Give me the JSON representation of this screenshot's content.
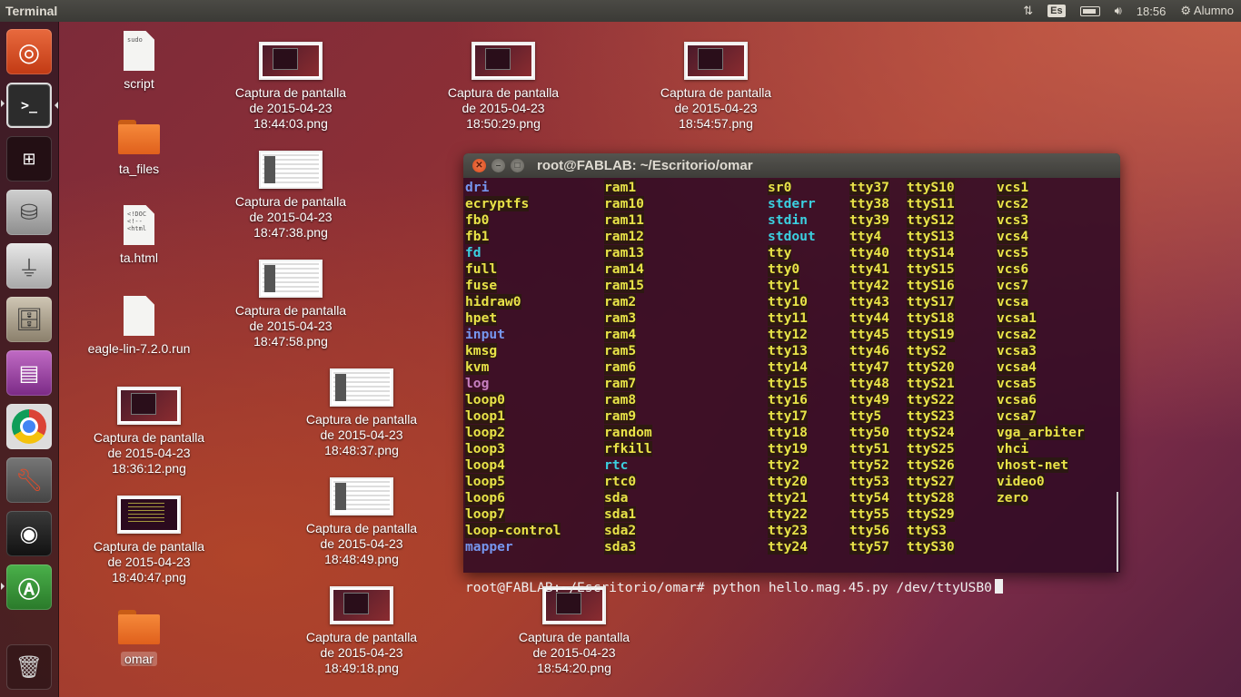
{
  "top_panel": {
    "app_title": "Terminal",
    "keyboard": "Es",
    "time": "18:56",
    "user": "Alumno"
  },
  "launcher": {
    "items": [
      "Ubuntu Dash",
      "Terminal",
      "Workspace Switcher",
      "Disk",
      "USB Drive",
      "Files",
      "Ubuntu Software",
      "Chrome",
      "System Settings",
      "Webcam",
      "Software Updater",
      "Trash"
    ]
  },
  "desktop": {
    "files": [
      {
        "label": "script",
        "badge": "sudo"
      },
      {
        "label": "ta_files"
      },
      {
        "label": "ta.html",
        "badge": "<!DOC\n<!--\n<html"
      },
      {
        "label": "eagle-lin-7.2.0.run"
      },
      {
        "label": "omar"
      }
    ],
    "screenshots": [
      {
        "l1": "Captura de pantalla",
        "l2": "de 2015-04-23",
        "l3": "18:44:03.png"
      },
      {
        "l1": "Captura de pantalla",
        "l2": "de 2015-04-23",
        "l3": "18:50:29.png"
      },
      {
        "l1": "Captura de pantalla",
        "l2": "de 2015-04-23",
        "l3": "18:54:57.png"
      },
      {
        "l1": "Captura de pantalla",
        "l2": "de 2015-04-23",
        "l3": "18:47:38.png"
      },
      {
        "l1": "Captura de pantalla",
        "l2": "de 2015-04-23",
        "l3": "18:47:58.png"
      },
      {
        "l1": "Captura de pantalla",
        "l2": "de 2015-04-23",
        "l3": "18:36:12.png"
      },
      {
        "l1": "Captura de pantalla",
        "l2": "de 2015-04-23",
        "l3": "18:48:37.png"
      },
      {
        "l1": "Captura de pantalla",
        "l2": "de 2015-04-23",
        "l3": "18:40:47.png"
      },
      {
        "l1": "Captura de pantalla",
        "l2": "de 2015-04-23",
        "l3": "18:48:49.png"
      },
      {
        "l1": "Captura de pantalla",
        "l2": "de 2015-04-23",
        "l3": "18:49:18.png"
      },
      {
        "l1": "Captura de pantalla",
        "l2": "de 2015-04-23",
        "l3": "18:54:20.png"
      }
    ]
  },
  "terminal": {
    "title": "root@FABLAB: ~/Escritorio/omar",
    "prompt": "root@FABLAB:~/Escritorio/omar# python hello.mag.45.py /dev/ttyUSB0",
    "columns": [
      [
        [
          "dri",
          "b"
        ],
        [
          "ecryptfs",
          "y"
        ],
        [
          "fb0",
          "y"
        ],
        [
          "fb1",
          "y"
        ],
        [
          "fd",
          "c"
        ],
        [
          "full",
          "y"
        ],
        [
          "fuse",
          "y"
        ],
        [
          "hidraw0",
          "y"
        ],
        [
          "hpet",
          "y"
        ],
        [
          "input",
          "b"
        ],
        [
          "kmsg",
          "y"
        ],
        [
          "kvm",
          "y"
        ],
        [
          "log",
          "m"
        ],
        [
          "loop0",
          "y"
        ],
        [
          "loop1",
          "y"
        ],
        [
          "loop2",
          "y"
        ],
        [
          "loop3",
          "y"
        ],
        [
          "loop4",
          "y"
        ],
        [
          "loop5",
          "y"
        ],
        [
          "loop6",
          "y"
        ],
        [
          "loop7",
          "y"
        ],
        [
          "loop-control",
          "y"
        ],
        [
          "mapper",
          "b"
        ]
      ],
      [
        [
          "ram1",
          "y"
        ],
        [
          "ram10",
          "y"
        ],
        [
          "ram11",
          "y"
        ],
        [
          "ram12",
          "y"
        ],
        [
          "ram13",
          "y"
        ],
        [
          "ram14",
          "y"
        ],
        [
          "ram15",
          "y"
        ],
        [
          "ram2",
          "y"
        ],
        [
          "ram3",
          "y"
        ],
        [
          "ram4",
          "y"
        ],
        [
          "ram5",
          "y"
        ],
        [
          "ram6",
          "y"
        ],
        [
          "ram7",
          "y"
        ],
        [
          "ram8",
          "y"
        ],
        [
          "ram9",
          "y"
        ],
        [
          "random",
          "y"
        ],
        [
          "rfkill",
          "y"
        ],
        [
          "rtc",
          "c"
        ],
        [
          "rtc0",
          "y"
        ],
        [
          "sda",
          "y"
        ],
        [
          "sda1",
          "y"
        ],
        [
          "sda2",
          "y"
        ],
        [
          "sda3",
          "y"
        ]
      ],
      [
        [
          "sr0",
          "y"
        ],
        [
          "stderr",
          "c"
        ],
        [
          "stdin",
          "c"
        ],
        [
          "stdout",
          "c"
        ],
        [
          "tty",
          "y"
        ],
        [
          "tty0",
          "y"
        ],
        [
          "tty1",
          "y"
        ],
        [
          "tty10",
          "y"
        ],
        [
          "tty11",
          "y"
        ],
        [
          "tty12",
          "y"
        ],
        [
          "tty13",
          "y"
        ],
        [
          "tty14",
          "y"
        ],
        [
          "tty15",
          "y"
        ],
        [
          "tty16",
          "y"
        ],
        [
          "tty17",
          "y"
        ],
        [
          "tty18",
          "y"
        ],
        [
          "tty19",
          "y"
        ],
        [
          "tty2",
          "y"
        ],
        [
          "tty20",
          "y"
        ],
        [
          "tty21",
          "y"
        ],
        [
          "tty22",
          "y"
        ],
        [
          "tty23",
          "y"
        ],
        [
          "tty24",
          "y"
        ]
      ],
      [
        [
          "tty37",
          "y"
        ],
        [
          "tty38",
          "y"
        ],
        [
          "tty39",
          "y"
        ],
        [
          "tty4",
          "y"
        ],
        [
          "tty40",
          "y"
        ],
        [
          "tty41",
          "y"
        ],
        [
          "tty42",
          "y"
        ],
        [
          "tty43",
          "y"
        ],
        [
          "tty44",
          "y"
        ],
        [
          "tty45",
          "y"
        ],
        [
          "tty46",
          "y"
        ],
        [
          "tty47",
          "y"
        ],
        [
          "tty48",
          "y"
        ],
        [
          "tty49",
          "y"
        ],
        [
          "tty5",
          "y"
        ],
        [
          "tty50",
          "y"
        ],
        [
          "tty51",
          "y"
        ],
        [
          "tty52",
          "y"
        ],
        [
          "tty53",
          "y"
        ],
        [
          "tty54",
          "y"
        ],
        [
          "tty55",
          "y"
        ],
        [
          "tty56",
          "y"
        ],
        [
          "tty57",
          "y"
        ]
      ],
      [
        [
          "ttyS10",
          "y"
        ],
        [
          "ttyS11",
          "y"
        ],
        [
          "ttyS12",
          "y"
        ],
        [
          "ttyS13",
          "y"
        ],
        [
          "ttyS14",
          "y"
        ],
        [
          "ttyS15",
          "y"
        ],
        [
          "ttyS16",
          "y"
        ],
        [
          "ttyS17",
          "y"
        ],
        [
          "ttyS18",
          "y"
        ],
        [
          "ttyS19",
          "y"
        ],
        [
          "ttyS2",
          "y"
        ],
        [
          "ttyS20",
          "y"
        ],
        [
          "ttyS21",
          "y"
        ],
        [
          "ttyS22",
          "y"
        ],
        [
          "ttyS23",
          "y"
        ],
        [
          "ttyS24",
          "y"
        ],
        [
          "ttyS25",
          "y"
        ],
        [
          "ttyS26",
          "y"
        ],
        [
          "ttyS27",
          "y"
        ],
        [
          "ttyS28",
          "y"
        ],
        [
          "ttyS29",
          "y"
        ],
        [
          "ttyS3",
          "y"
        ],
        [
          "ttyS30",
          "y"
        ]
      ],
      [
        [
          "vcs1",
          "y"
        ],
        [
          "vcs2",
          "y"
        ],
        [
          "vcs3",
          "y"
        ],
        [
          "vcs4",
          "y"
        ],
        [
          "vcs5",
          "y"
        ],
        [
          "vcs6",
          "y"
        ],
        [
          "vcs7",
          "y"
        ],
        [
          "vcsa",
          "y"
        ],
        [
          "vcsa1",
          "y"
        ],
        [
          "vcsa2",
          "y"
        ],
        [
          "vcsa3",
          "y"
        ],
        [
          "vcsa4",
          "y"
        ],
        [
          "vcsa5",
          "y"
        ],
        [
          "vcsa6",
          "y"
        ],
        [
          "vcsa7",
          "y"
        ],
        [
          "vga_arbiter",
          "y"
        ],
        [
          "vhci",
          "y"
        ],
        [
          "vhost-net",
          "y"
        ],
        [
          "video0",
          "y"
        ],
        [
          "zero",
          "y"
        ]
      ]
    ]
  }
}
